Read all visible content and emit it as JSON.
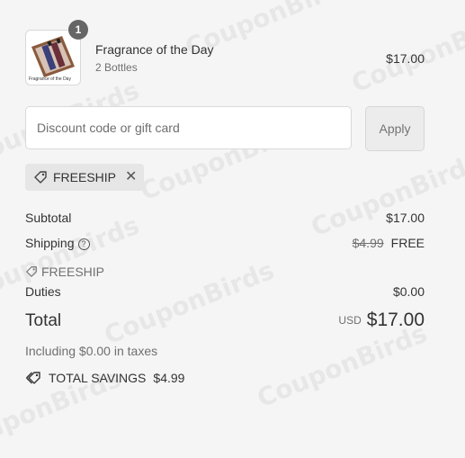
{
  "watermark": "CouponBirds",
  "line_item": {
    "name": "Fragrance of the Day",
    "variant": "2 Bottles",
    "price": "$17.00",
    "quantity": "1",
    "thumbnail_caption": "Fragrance of the Day"
  },
  "discount": {
    "placeholder": "Discount code or gift card",
    "apply_label": "Apply",
    "applied_code": "FREESHIP"
  },
  "summary": {
    "subtotal_label": "Subtotal",
    "subtotal_value": "$17.00",
    "shipping_label": "Shipping",
    "shipping_original": "$4.99",
    "shipping_value": "FREE",
    "shipping_code": "FREESHIP",
    "duties_label": "Duties",
    "duties_value": "$0.00",
    "total_label": "Total",
    "currency": "USD",
    "total_value": "$17.00",
    "tax_note": "Including $0.00 in taxes",
    "savings_label": "TOTAL SAVINGS",
    "savings_value": "$4.99"
  }
}
